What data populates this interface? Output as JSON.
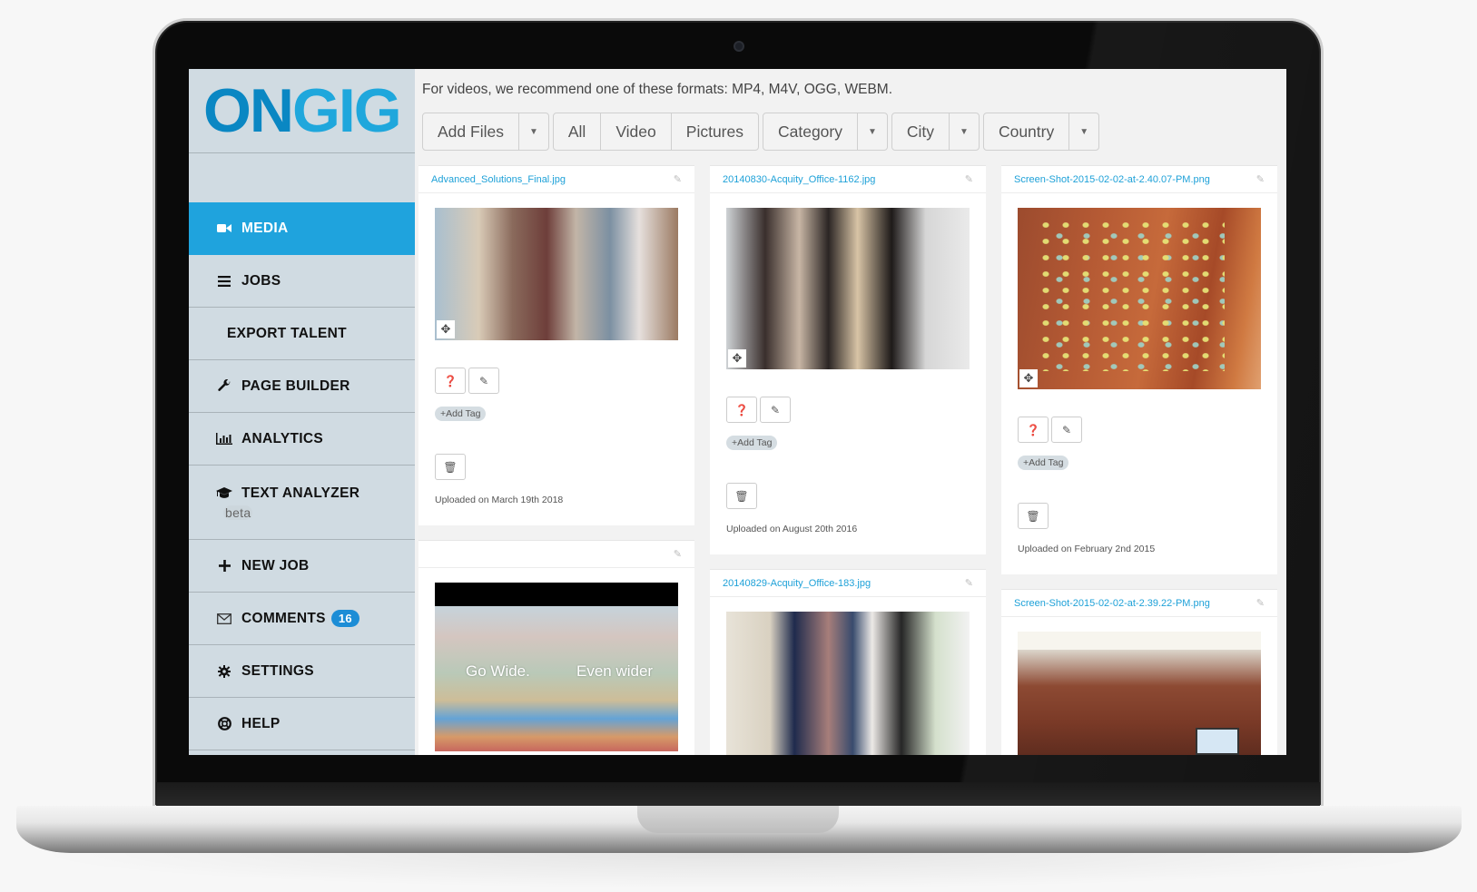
{
  "brand": {
    "logo_part1": "ON",
    "logo_part2": "GIG",
    "primary_color": "#0a87c3",
    "accent_color": "#1fa3dd"
  },
  "sidebar": {
    "items": [
      {
        "label": "MEDIA",
        "icon": "video-camera-icon",
        "active": true
      },
      {
        "label": "JOBS",
        "icon": "list-icon"
      },
      {
        "label": "EXPORT TALENT"
      },
      {
        "label": "PAGE BUILDER",
        "icon": "wrench-icon"
      },
      {
        "label": "ANALYTICS",
        "icon": "bar-chart-icon"
      },
      {
        "label": "TEXT ANALYZER",
        "icon": "graduation-cap-icon",
        "sublabel": "beta"
      },
      {
        "label": "NEW JOB",
        "icon": "plus-icon"
      },
      {
        "label": "COMMENTS",
        "icon": "envelope-icon",
        "badge": "16"
      },
      {
        "label": "SETTINGS",
        "icon": "gear-icon"
      },
      {
        "label": "HELP",
        "icon": "life-ring-icon"
      }
    ]
  },
  "main": {
    "hint": "For videos, we recommend one of these formats: MP4, M4V, OGG, WEBM.",
    "toolbar": {
      "add_files": "Add Files",
      "filter_all": "All",
      "filter_video": "Video",
      "filter_pictures": "Pictures",
      "category": "Category",
      "city": "City",
      "country": "Country"
    },
    "cards": [
      {
        "filename": "Advanced_Solutions_Final.jpg",
        "uploaded": "Uploaded on March 19th 2018",
        "add_tag": "+Add Tag"
      },
      {
        "filename": "20140830-Acquity_Office-1162.jpg",
        "uploaded": "Uploaded on August 20th 2016",
        "add_tag": "+Add Tag"
      },
      {
        "filename": "Screen-Shot-2015-02-02-at-2.40.07-PM.png",
        "uploaded": "Uploaded on February 2nd 2015",
        "add_tag": "+Add Tag"
      },
      {
        "filename": "",
        "video_overlay_left": "Go Wide.",
        "video_overlay_right": "Even wider"
      },
      {
        "filename": "20140829-Acquity_Office-183.jpg"
      },
      {
        "filename": "Screen-Shot-2015-02-02-at-2.39.22-PM.png"
      }
    ]
  }
}
